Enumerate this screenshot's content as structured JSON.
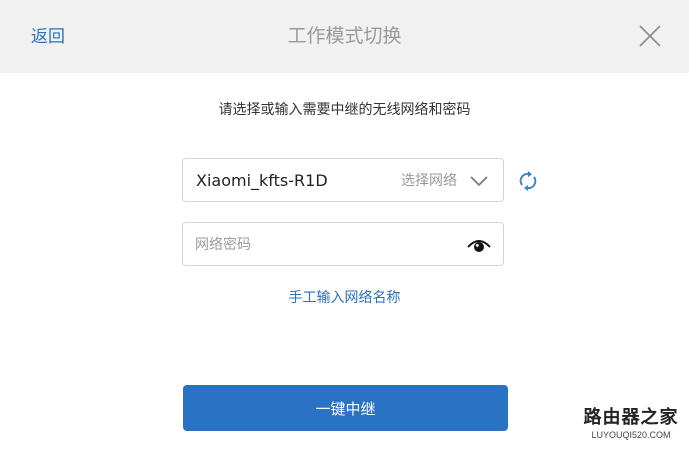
{
  "header": {
    "back_label": "返回",
    "title": "工作模式切换"
  },
  "instruction": "请选择或输入需要中继的无线网络和密码",
  "network_select": {
    "selected_value": "Xiaomi_kfts-R1D",
    "hint": "选择网络"
  },
  "password": {
    "placeholder": "网络密码",
    "value": ""
  },
  "manual_entry_label": "手工输入网络名称",
  "submit_label": "一键中继",
  "watermark": {
    "brand": "路由器之家",
    "url": "LUYOUQI520.COM"
  },
  "colors": {
    "accent": "#2a72c4",
    "link": "#2a72bd",
    "header_bg": "#f1f1f1",
    "border": "#d6d6d6"
  }
}
